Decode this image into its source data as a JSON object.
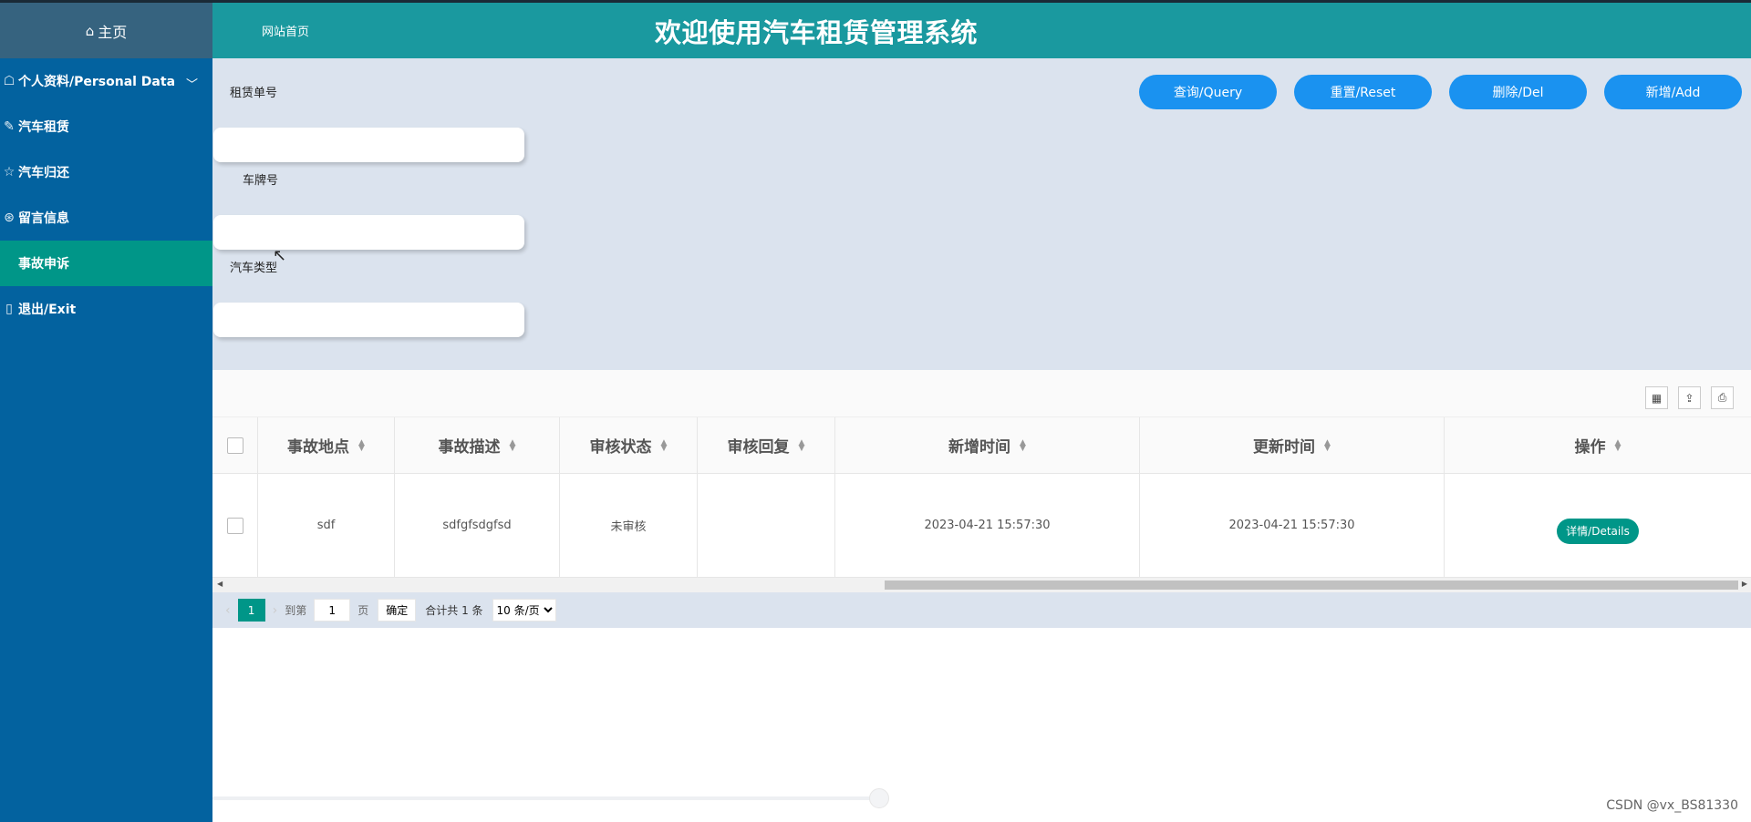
{
  "sidebar": {
    "home": {
      "label": "主页",
      "icon": "home-icon"
    },
    "items": [
      {
        "label": "个人资料/Personal Data",
        "icon": "user-icon",
        "expand": "﹀"
      },
      {
        "label": "汽车租赁",
        "icon": "car-icon"
      },
      {
        "label": "汽车归还",
        "icon": "return-icon"
      },
      {
        "label": "留言信息",
        "icon": "message-icon"
      },
      {
        "label": "事故申诉",
        "icon": "",
        "active": true
      },
      {
        "label": "退出/Exit",
        "icon": "exit-icon"
      }
    ]
  },
  "header": {
    "home_link": "网站首页",
    "title": "欢迎使用汽车租赁管理系统"
  },
  "search": {
    "fields": [
      {
        "label": "租赁单号",
        "value": ""
      },
      {
        "label": "车牌号",
        "value": ""
      },
      {
        "label": "汽车类型",
        "value": ""
      }
    ],
    "buttons": {
      "query": "查询/Query",
      "reset": "重置/Reset",
      "delete": "删除/Del",
      "add": "新增/Add"
    }
  },
  "toolbar": {
    "filter_icon": "columns-icon",
    "export_icon": "export-icon",
    "print_icon": "print-icon"
  },
  "table": {
    "columns": [
      "事故地点",
      "事故描述",
      "审核状态",
      "审核回复",
      "新增时间",
      "更新时间",
      "操作"
    ],
    "rows": [
      {
        "location": "sdf",
        "description": "sdfgfsdgfsd",
        "status": "未审核",
        "reply": "",
        "created": "2023-04-21 15:57:30",
        "updated": "2023-04-21 15:57:30",
        "action": "详情/Details"
      }
    ]
  },
  "pager": {
    "current": "1",
    "goto_label": "到第",
    "goto_value": "1",
    "page_unit": "页",
    "confirm": "确定",
    "total": "合计共 1 条",
    "page_size": "10 条/页"
  },
  "watermark": "CSDN @vx_BS81330",
  "colors": {
    "sidebar": "#03629f",
    "header": "#1a999f",
    "active": "#009688",
    "button": "#1a92f0",
    "search_bg": "#dbe3ee"
  }
}
